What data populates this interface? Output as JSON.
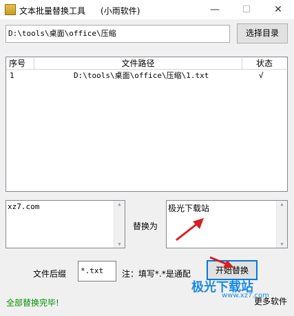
{
  "window": {
    "title": "文本批量替换工具",
    "subtitle": "(小雨软件)",
    "minimize_glyph": "—",
    "maximize_glyph": "☐",
    "close_glyph": "✕"
  },
  "path_field": {
    "value": "D:\\tools\\桌面\\office\\压缩"
  },
  "select_dir_button": "选择目录",
  "list": {
    "headers": {
      "index": "序号",
      "path": "文件路径",
      "status": "状态"
    },
    "rows": [
      {
        "index": "1",
        "path": "D:\\tools\\桌面\\office\\压缩\\1.txt",
        "status": "√"
      }
    ]
  },
  "find_text": "xz7.com",
  "replace_label": "替换为",
  "replace_text": "极光下载站",
  "suffix": {
    "label": "文件后缀",
    "value": "*.txt",
    "note": "注：填写*.*是通配"
  },
  "start_button": "开始替换",
  "status": "全部替换完毕!",
  "more_link": "更多软件",
  "watermark": {
    "text": "极光下载站",
    "url": "www.xz7.com"
  },
  "colors": {
    "status_green": "#009000",
    "arrow_red": "#d81e1e",
    "focus_blue": "#0078d7"
  }
}
